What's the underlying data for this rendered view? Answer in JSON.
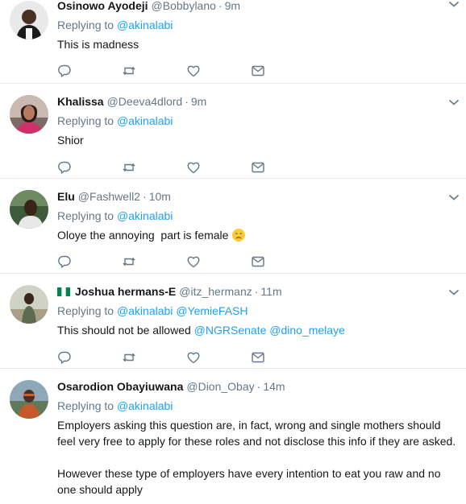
{
  "tweets": [
    {
      "name": "Osinowo Ayodeji",
      "handle": "@Bobbylano",
      "separator": "·",
      "time": "9m",
      "replying_prefix": "Replying to",
      "mentions": [
        "@akinalabi"
      ],
      "text": [
        "This is madness"
      ]
    },
    {
      "name": "Khalissa",
      "handle": "@Deeva4dlord",
      "separator": "·",
      "time": "9m",
      "replying_prefix": "Replying to",
      "mentions": [
        "@akinalabi"
      ],
      "text": [
        "Shior"
      ]
    },
    {
      "name": "Elu",
      "handle": "@Fashwell2",
      "separator": "·",
      "time": "10m",
      "replying_prefix": "Replying to",
      "mentions": [
        "@akinalabi"
      ],
      "text": [
        "Oloye the annoying  part is female"
      ],
      "text_emoji": "crying-face-emoji"
    },
    {
      "name": "Joshua hermans-E",
      "handle": "@itz_hermanz",
      "separator": "·",
      "time": "11m",
      "replying_prefix": "Replying to",
      "mentions": [
        "@akinalabi",
        "@YemieFASH"
      ],
      "text_prefix": "This should not be allowed",
      "text_mentions": [
        "@NGRSenate",
        "@dino_melaye"
      ],
      "flag": "nigeria-flag-icon"
    },
    {
      "name": "Osarodion Obayiuwana",
      "handle": "@Dion_Obay",
      "separator": "·",
      "time": "14m",
      "replying_prefix": "Replying to",
      "mentions": [
        "@akinalabi"
      ],
      "text": [
        "Employers asking this question are, in fact, wrong and single mothers should feel very free to apply for these roles and not disclose this info if they are asked.",
        "However these type of employers have every intention to eat you raw and no one should apply"
      ]
    }
  ],
  "icons": {
    "reply": "reply-icon",
    "retweet": "retweet-icon",
    "like": "heart-icon",
    "message": "direct-message-icon",
    "menu": "chevron-down-icon"
  },
  "colors": {
    "name": "#14171a",
    "secondary": "#657786",
    "link": "#1da1f2",
    "divider": "#e6ecf0",
    "background": "#ffffff"
  }
}
